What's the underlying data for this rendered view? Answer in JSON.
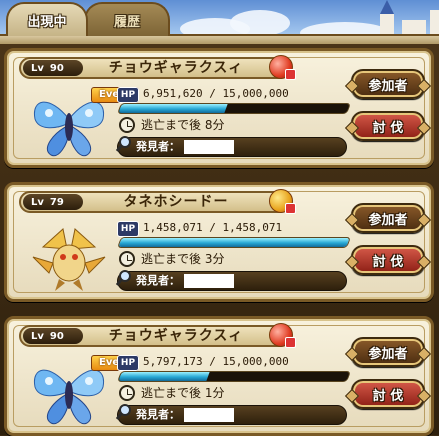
{
  "tabs": [
    {
      "label": "出現中",
      "active": true
    },
    {
      "label": "履歴",
      "active": false
    }
  ],
  "cards": [
    {
      "level": "90",
      "name": "チョウギャラクスィ",
      "event": true,
      "event_label": "Event",
      "hp_current": "6,951,620",
      "hp_max": "15,000,000",
      "hp_text": "6,951,620 / 15,000,000",
      "hp_ratio": 0.4634,
      "escape": "逃亡まで後 8分",
      "finder_label": "発見者：",
      "join_label": "参加者",
      "fight_label": "討 伐",
      "orb": "red",
      "monster": "butterfly"
    },
    {
      "level": "79",
      "name": "タネホシードー",
      "event": false,
      "event_label": "",
      "hp_current": "1,458,071",
      "hp_max": "1,458,071",
      "hp_text": "1,458,071 / 1,458,071",
      "hp_ratio": 1.0,
      "escape": "逃亡まで後 3分",
      "finder_label": "発見者：",
      "join_label": "参加者",
      "fight_label": "討 伐",
      "orb": "gold",
      "monster": "dragon"
    },
    {
      "level": "90",
      "name": "チョウギャラクスィ",
      "event": true,
      "event_label": "Event",
      "hp_current": "5,797,173",
      "hp_max": "15,000,000",
      "hp_text": "5,797,173 / 15,000,000",
      "hp_ratio": 0.3865,
      "escape": "逃亡まで後 1分",
      "finder_label": "発見者：",
      "join_label": "参加者",
      "fight_label": "討 伐",
      "orb": "red",
      "monster": "butterfly"
    }
  ],
  "labels": {
    "lv": "Lv",
    "hp": "HP"
  },
  "colors": {
    "hp_fill": "#27a7d4",
    "fight_button": "#c0392b",
    "join_button": "#6b4420",
    "card_bg": "#f3ead0"
  }
}
